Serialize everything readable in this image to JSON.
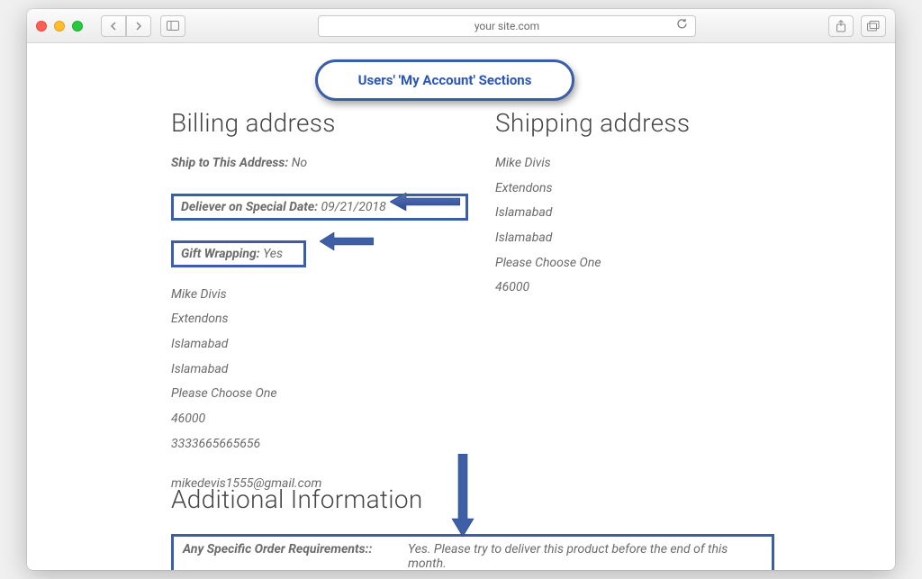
{
  "browser": {
    "url": "your site.com"
  },
  "callout": {
    "label": "Users' 'My Account' Sections"
  },
  "billing": {
    "heading": "Billing address",
    "ship_to_label": "Ship to This Address:",
    "ship_to_value": "No",
    "deliver_label": "Deliever on Special Date:",
    "deliver_value": "09/21/2018",
    "gift_label": "Gift Wrapping:",
    "gift_value": "Yes",
    "lines": [
      "Mike Divis",
      "Extendons",
      "Islamabad",
      "Islamabad",
      "Please Choose One",
      "46000",
      "3333665665656"
    ],
    "email": "mikedevis1555@gmail.com"
  },
  "shipping": {
    "heading": "Shipping address",
    "lines": [
      "Mike Divis",
      "Extendons",
      "Islamabad",
      "Islamabad",
      "Please Choose One",
      "46000"
    ]
  },
  "additional": {
    "heading": "Additional Information",
    "req_label": "Any Specific Order Requirements::",
    "req_value": "Yes. Please try to deliver this product before the end of this month."
  },
  "colors": {
    "annotation": "#3a5ea8"
  }
}
